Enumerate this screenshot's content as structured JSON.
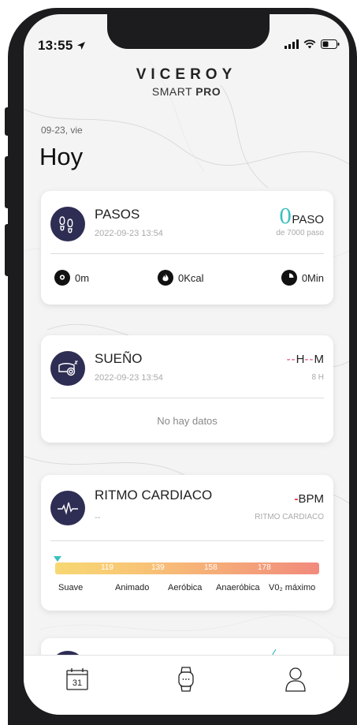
{
  "status_bar": {
    "time": "13:55"
  },
  "brand": {
    "name": "VICEROY",
    "sub_a": "SMART ",
    "sub_b": "PRO"
  },
  "header": {
    "date": "09-23, vie",
    "title": "Hoy"
  },
  "steps_card": {
    "title": "PASOS",
    "timestamp": "2022-09-23 13:54",
    "value": "0",
    "unit": "PASO",
    "goal": "de 7000 paso",
    "distance": "0m",
    "calories": "0Kcal",
    "minutes": "0Min"
  },
  "sleep_card": {
    "title": "SUEÑO",
    "timestamp": "2022-09-23 13:54",
    "hours_dash": "--",
    "h_label": "H",
    "min_dash": "--",
    "m_label": "M",
    "goal": "8 H",
    "empty": "No hay datos"
  },
  "heart_card": {
    "title": "RITMO CARDIACO",
    "subtitle": "--",
    "value_dash": "-",
    "unit": "BPM",
    "unit_sub": "RITMO CARDIACO",
    "ticks": [
      "119",
      "139",
      "158",
      "178"
    ],
    "zones": [
      "Suave",
      "Animado",
      "Aeróbica",
      "Anaeróbica",
      "V0₂ máximo"
    ]
  },
  "icons": {
    "steps": "footprints-icon",
    "location": "location-pin-icon",
    "flame": "flame-icon",
    "clock": "clock-icon",
    "sleep": "sleep-bed-icon",
    "heart": "heartbeat-icon",
    "calendar": "calendar-icon",
    "watch": "watch-icon",
    "profile": "profile-icon"
  },
  "tabbar": {
    "calendar_day": "31"
  },
  "colors": {
    "accent_teal": "#3bbfbf",
    "accent_pink": "#e04080",
    "accent_red": "#e53340",
    "circle_bg": "#2e2d54"
  }
}
